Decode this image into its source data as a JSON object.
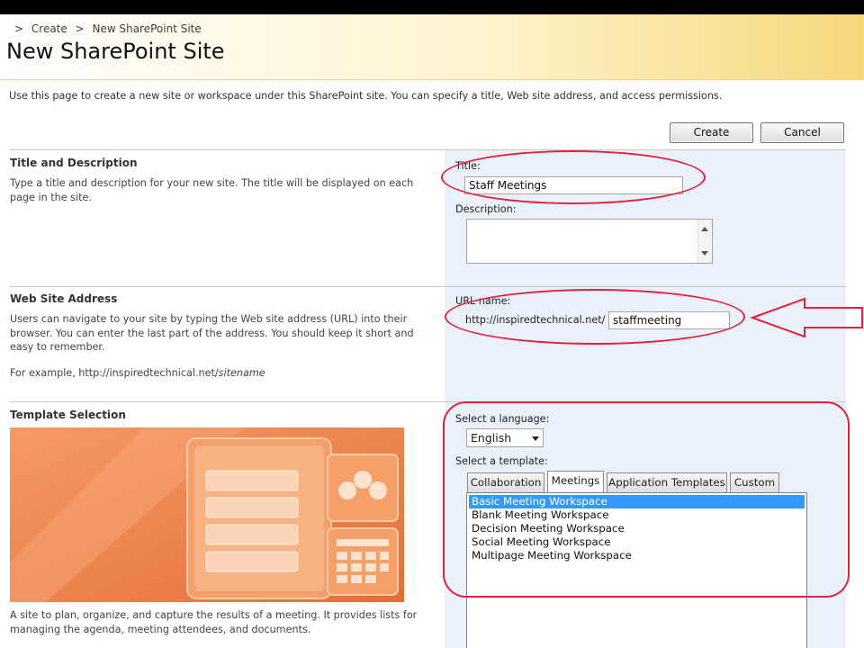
{
  "breadcrumb": {
    "separator": ">",
    "items": [
      "Create",
      "New SharePoint Site"
    ]
  },
  "page": {
    "title": "New SharePoint Site",
    "intro": "Use this page to create a new site or workspace under this SharePoint site. You can specify a title, Web site address, and access permissions."
  },
  "buttons": {
    "create": "Create",
    "cancel": "Cancel"
  },
  "title_section": {
    "heading": "Title and Description",
    "description": "Type a title and description for your new site. The title will be displayed on each page in the site.",
    "title_label": "Title:",
    "title_value": "Staff Meetings",
    "description_label": "Description:",
    "description_value": ""
  },
  "address_section": {
    "heading": "Web Site Address",
    "description": "Users can navigate to your site by typing the Web site address (URL) into their browser. You can enter the last part of the address. You should keep it short and easy to remember.",
    "example_prefix": "For example, http://inspiredtechnical.net/",
    "example_suffix": "sitename",
    "url_label": "URL name:",
    "url_prefix": "http://inspiredtechnical.net/",
    "url_value": "staffmeeting"
  },
  "template_section": {
    "heading": "Template Selection",
    "description": "A site to plan, organize, and capture the results of a meeting. It provides lists for managing the agenda, meeting attendees, and documents.",
    "language_label": "Select a language:",
    "language_value": "English",
    "template_label": "Select a template:",
    "tabs": [
      "Collaboration",
      "Meetings",
      "Application Templates",
      "Custom"
    ],
    "active_tab": "Meetings",
    "templates": [
      "Basic Meeting Workspace",
      "Blank Meeting Workspace",
      "Decision Meeting Workspace",
      "Social Meeting Workspace",
      "Multipage Meeting Workspace"
    ],
    "selected_template": "Basic Meeting Workspace"
  },
  "colors": {
    "annotation": "#e3213a",
    "header_gradient_end": "#f6d77a",
    "right_panel": "#eaf1fb",
    "selection": "#3399ff",
    "preview_orange": "#f0884e"
  },
  "icons": [
    "dropdown-arrow-icon",
    "scroll-up-icon",
    "scroll-down-icon",
    "annotation-arrow-icon"
  ]
}
